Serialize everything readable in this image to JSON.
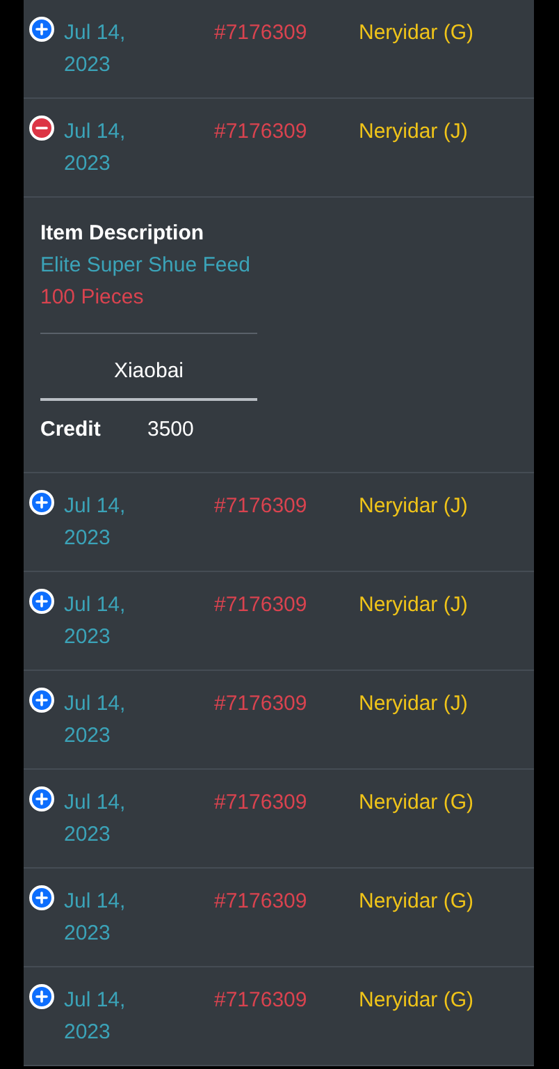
{
  "rows": [
    {
      "expanded": false,
      "date": "Jul 14, 2023",
      "order": "#7176309",
      "customer": "Neryidar (G)"
    },
    {
      "expanded": true,
      "date": "Jul 14, 2023",
      "order": "#7176309",
      "customer": "Neryidar (J)",
      "details": {
        "heading": "Item Description",
        "item": "Elite Super Shue Feed",
        "quantity": "100 Pieces",
        "name_field": "Xiaobai",
        "credit_label": "Credit",
        "credit_value": "3500"
      }
    },
    {
      "expanded": false,
      "date": "Jul 14, 2023",
      "order": "#7176309",
      "customer": "Neryidar (J)"
    },
    {
      "expanded": false,
      "date": "Jul 14, 2023",
      "order": "#7176309",
      "customer": "Neryidar (J)"
    },
    {
      "expanded": false,
      "date": "Jul 14, 2023",
      "order": "#7176309",
      "customer": "Neryidar (J)"
    },
    {
      "expanded": false,
      "date": "Jul 14, 2023",
      "order": "#7176309",
      "customer": "Neryidar (G)"
    },
    {
      "expanded": false,
      "date": "Jul 14, 2023",
      "order": "#7176309",
      "customer": "Neryidar (G)"
    },
    {
      "expanded": false,
      "date": "Jul 14, 2023",
      "order": "#7176309",
      "customer": "Neryidar (G)"
    }
  ]
}
